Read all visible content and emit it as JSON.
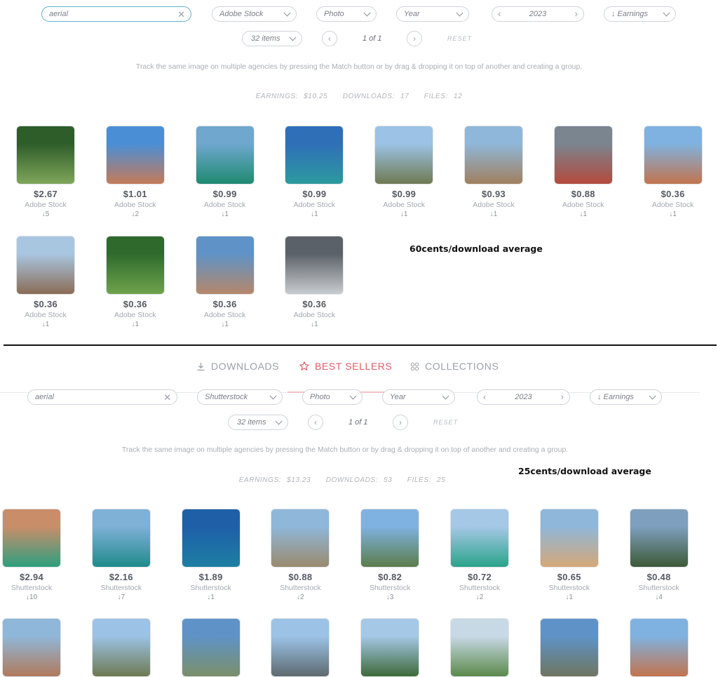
{
  "colors": {
    "accent": "#e25b66",
    "search_border": "#5fb3c9"
  },
  "top": {
    "filters": {
      "search_value": "aerial",
      "agency": "Adobe Stock",
      "media": "Photo",
      "period": "Year",
      "year": "2023",
      "sort": "↓ Earnings",
      "items": "32 items",
      "page": "1 of 1",
      "reset": "RESET"
    },
    "hint": "Track the same image on multiple agencies by pressing the Match button or by drag & dropping it on top of another and creating a group.",
    "stats": {
      "earnings_label": "EARNINGS:",
      "earnings": "$10.25",
      "downloads_label": "DOWNLOADS:",
      "downloads": "17",
      "files_label": "FILES:",
      "files": "12"
    },
    "note": "60cents/download average",
    "cards": [
      {
        "price": "$2.67",
        "agency": "Adobe Stock",
        "dl": "↓5",
        "c1": "#2e5d2a",
        "c2": "#7fa65a"
      },
      {
        "price": "$1.01",
        "agency": "Adobe Stock",
        "dl": "↓2",
        "c1": "#4a8fd6",
        "c2": "#c47a58"
      },
      {
        "price": "$0.99",
        "agency": "Adobe Stock",
        "dl": "↓1",
        "c1": "#6fa7cf",
        "c2": "#1f8a70"
      },
      {
        "price": "$0.99",
        "agency": "Adobe Stock",
        "dl": "↓1",
        "c1": "#2f6fb8",
        "c2": "#2c9a9e"
      },
      {
        "price": "$0.99",
        "agency": "Adobe Stock",
        "dl": "↓1",
        "c1": "#9cc3e6",
        "c2": "#6f7a52"
      },
      {
        "price": "$0.93",
        "agency": "Adobe Stock",
        "dl": "↓1",
        "c1": "#8fb7d9",
        "c2": "#a0805e"
      },
      {
        "price": "$0.88",
        "agency": "Adobe Stock",
        "dl": "↓1",
        "c1": "#7a858f",
        "c2": "#b44a3d"
      },
      {
        "price": "$0.36",
        "agency": "Adobe Stock",
        "dl": "↓1",
        "c1": "#7fb2e0",
        "c2": "#c2744e"
      },
      {
        "price": "$0.36",
        "agency": "Adobe Stock",
        "dl": "↓1",
        "c1": "#a9c6e0",
        "c2": "#8a6c56"
      },
      {
        "price": "$0.36",
        "agency": "Adobe Stock",
        "dl": "↓1",
        "c1": "#2f6a2c",
        "c2": "#6ea34c"
      },
      {
        "price": "$0.36",
        "agency": "Adobe Stock",
        "dl": "↓1",
        "c1": "#5f93c7",
        "c2": "#b5876a"
      },
      {
        "price": "$0.36",
        "agency": "Adobe Stock",
        "dl": "↓1",
        "c1": "#5b6168",
        "c2": "#c8ccd0"
      }
    ]
  },
  "bottom": {
    "tabs": [
      {
        "label": "DOWNLOADS",
        "icon": "download-icon"
      },
      {
        "label": "BEST SELLERS",
        "icon": "star-icon"
      },
      {
        "label": "COLLECTIONS",
        "icon": "grid-icon"
      }
    ],
    "filters": {
      "search_value": "aerial",
      "agency": "Shutterstock",
      "media": "Photo",
      "period": "Year",
      "year": "2023",
      "sort": "↓ Earnings",
      "items": "32 items",
      "page": "1 of 1",
      "reset": "RESET"
    },
    "hint": "Track the same image on multiple agencies by pressing the Match button or by drag & dropping it on top of another and creating a group.",
    "stats": {
      "earnings_label": "EARNINGS:",
      "earnings": "$13.23",
      "downloads_label": "DOWNLOADS:",
      "downloads": "53",
      "files_label": "FILES:",
      "files": "25"
    },
    "note": "25cents/download average",
    "cards": [
      {
        "price": "$2.94",
        "agency": "Shutterstock",
        "dl": "↓10",
        "c1": "#c98d6a",
        "c2": "#2e9f7e"
      },
      {
        "price": "$2.16",
        "agency": "Shutterstock",
        "dl": "↓7",
        "c1": "#7fb0d6",
        "c2": "#1f8a8c"
      },
      {
        "price": "$1.89",
        "agency": "Shutterstock",
        "dl": "↓1",
        "c1": "#1e5fa8",
        "c2": "#1d7fa3"
      },
      {
        "price": "$0.88",
        "agency": "Shutterstock",
        "dl": "↓2",
        "c1": "#8fb7d9",
        "c2": "#9a8a6e"
      },
      {
        "price": "$0.82",
        "agency": "Shutterstock",
        "dl": "↓3",
        "c1": "#7fb2e0",
        "c2": "#5c7d4a"
      },
      {
        "price": "$0.72",
        "agency": "Shutterstock",
        "dl": "↓2",
        "c1": "#a5c8e6",
        "c2": "#2aa38a"
      },
      {
        "price": "$0.65",
        "agency": "Shutterstock",
        "dl": "↓1",
        "c1": "#8fb7d9",
        "c2": "#d4a878"
      },
      {
        "price": "$0.48",
        "agency": "Shutterstock",
        "dl": "↓4",
        "c1": "#7e9fbd",
        "c2": "#3d5a38"
      }
    ],
    "row2": [
      {
        "c1": "#8fb7d9",
        "c2": "#b07a5c"
      },
      {
        "c1": "#9cc3e6",
        "c2": "#6f7a52"
      },
      {
        "c1": "#5f93c7",
        "c2": "#7a8f6a"
      },
      {
        "c1": "#9cc3e6",
        "c2": "#5e6a70"
      },
      {
        "c1": "#a5c8e6",
        "c2": "#3f6a3a"
      },
      {
        "c1": "#c8d9e6",
        "c2": "#5b8a4a"
      },
      {
        "c1": "#5f93c7",
        "c2": "#6f7560"
      },
      {
        "c1": "#7fb2e0",
        "c2": "#c2744e"
      }
    ]
  }
}
